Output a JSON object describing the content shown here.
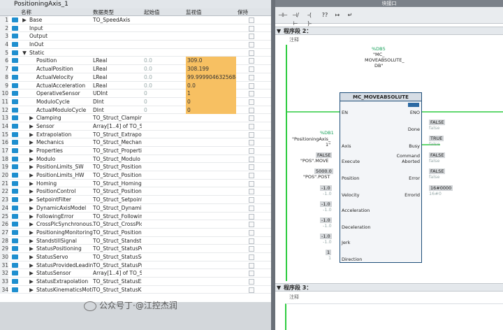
{
  "db_title": "PositioningAxis_1",
  "columns": {
    "name": "名称",
    "type": "数据类型",
    "start": "起始值",
    "monitor": "监视值",
    "retain": "保持"
  },
  "rows": [
    {
      "n": "1",
      "tri": "▶",
      "name": "Base",
      "type": "TO_SpeedAxis",
      "start": "",
      "mon": "",
      "ind": 0
    },
    {
      "n": "2",
      "tri": "",
      "name": "Input",
      "type": "",
      "start": "",
      "mon": "",
      "ind": 0
    },
    {
      "n": "3",
      "tri": "",
      "name": "Output",
      "type": "",
      "start": "",
      "mon": "",
      "ind": 0
    },
    {
      "n": "4",
      "tri": "",
      "name": "InOut",
      "type": "",
      "start": "",
      "mon": "",
      "ind": 0
    },
    {
      "n": "5",
      "tri": "▼",
      "name": "Static",
      "type": "",
      "start": "",
      "mon": "",
      "ind": 0
    },
    {
      "n": "6",
      "tri": "",
      "name": "Position",
      "type": "LReal",
      "start": "0.0",
      "mon": "309.0",
      "ind": 1
    },
    {
      "n": "7",
      "tri": "",
      "name": "ActualPosition",
      "type": "LReal",
      "start": "0.0",
      "mon": "308.199",
      "ind": 1
    },
    {
      "n": "8",
      "tri": "",
      "name": "ActualVelocity",
      "type": "LReal",
      "start": "0.0",
      "mon": "99.9999046325684",
      "ind": 1
    },
    {
      "n": "9",
      "tri": "",
      "name": "ActualAcceleration",
      "type": "LReal",
      "start": "0.0",
      "mon": "0.0",
      "ind": 1
    },
    {
      "n": "10",
      "tri": "",
      "name": "OperativeSensor",
      "type": "UDInt",
      "start": "0",
      "mon": "1",
      "ind": 1
    },
    {
      "n": "11",
      "tri": "",
      "name": "ModuloCycle",
      "type": "DInt",
      "start": "0",
      "mon": "0",
      "ind": 1
    },
    {
      "n": "12",
      "tri": "",
      "name": "ActualModuloCycle",
      "type": "DInt",
      "start": "0",
      "mon": "0",
      "ind": 1
    },
    {
      "n": "13",
      "tri": "▶",
      "name": "Clamping",
      "type": "TO_Struct_Clamping",
      "start": "",
      "mon": "",
      "ind": 1
    },
    {
      "n": "14",
      "tri": "▶",
      "name": "Sensor",
      "type": "Array[1..4] of TO_S...",
      "start": "",
      "mon": "",
      "ind": 1
    },
    {
      "n": "15",
      "tri": "▶",
      "name": "Extrapolation",
      "type": "TO_Struct_Extrapol...",
      "start": "",
      "mon": "",
      "ind": 1
    },
    {
      "n": "16",
      "tri": "▶",
      "name": "Mechanics",
      "type": "TO_Struct_Mechani...",
      "start": "",
      "mon": "",
      "ind": 1
    },
    {
      "n": "17",
      "tri": "▶",
      "name": "Properties",
      "type": "TO_Struct_Properties",
      "start": "",
      "mon": "",
      "ind": 1
    },
    {
      "n": "18",
      "tri": "▶",
      "name": "Modulo",
      "type": "TO_Struct_Modulo",
      "start": "",
      "mon": "",
      "ind": 1
    },
    {
      "n": "19",
      "tri": "▶",
      "name": "PositionLimits_SW",
      "type": "TO_Struct_Position...",
      "start": "",
      "mon": "",
      "ind": 1
    },
    {
      "n": "20",
      "tri": "▶",
      "name": "PositionLimits_HW",
      "type": "TO_Struct_Position...",
      "start": "",
      "mon": "",
      "ind": 1
    },
    {
      "n": "21",
      "tri": "▶",
      "name": "Homing",
      "type": "TO_Struct_Homing",
      "start": "",
      "mon": "",
      "ind": 1
    },
    {
      "n": "22",
      "tri": "▶",
      "name": "PositionControl",
      "type": "TO_Struct_Position...",
      "start": "",
      "mon": "",
      "ind": 1
    },
    {
      "n": "23",
      "tri": "▶",
      "name": "SetpointFilter",
      "type": "TO_Struct_Setpoint...",
      "start": "",
      "mon": "",
      "ind": 1
    },
    {
      "n": "24",
      "tri": "▶",
      "name": "DynamicAxisModel",
      "type": "TO_Struct_Dynami...",
      "start": "",
      "mon": "",
      "ind": 1
    },
    {
      "n": "25",
      "tri": "▶",
      "name": "FollowingError",
      "type": "TO_Struct_Followin...",
      "start": "",
      "mon": "",
      "ind": 1
    },
    {
      "n": "26",
      "tri": "▶",
      "name": "CrossPlcSynchronous...",
      "type": "TO_Struct_CrossPlc...",
      "start": "",
      "mon": "",
      "ind": 1
    },
    {
      "n": "27",
      "tri": "▶",
      "name": "PositioningMonitoring",
      "type": "TO_Struct_Positioni...",
      "start": "",
      "mon": "",
      "ind": 1
    },
    {
      "n": "28",
      "tri": "▶",
      "name": "StandstillSignal",
      "type": "TO_Struct_Standstil...",
      "start": "",
      "mon": "",
      "ind": 1
    },
    {
      "n": "29",
      "tri": "▶",
      "name": "StatusPositioning",
      "type": "TO_Struct_StatusPo...",
      "start": "",
      "mon": "",
      "ind": 1
    },
    {
      "n": "30",
      "tri": "▶",
      "name": "StatusServo",
      "type": "TO_Struct_StatusSe...",
      "start": "",
      "mon": "",
      "ind": 1
    },
    {
      "n": "31",
      "tri": "▶",
      "name": "StatusProvidedLeadin...",
      "type": "TO_Struct_StatusPr...",
      "start": "",
      "mon": "",
      "ind": 1
    },
    {
      "n": "32",
      "tri": "▶",
      "name": "StatusSensor",
      "type": "Array[1..4] of TO_S...",
      "start": "",
      "mon": "",
      "ind": 1
    },
    {
      "n": "33",
      "tri": "▶",
      "name": "StatusExtrapolation",
      "type": "TO_Struct_StatusEx...",
      "start": "",
      "mon": "",
      "ind": 1
    },
    {
      "n": "34",
      "tri": "▶",
      "name": "StatusKinematicsMoti...",
      "type": "TO_Struct_StatusKi...",
      "start": "",
      "mon": "",
      "ind": 1
    }
  ],
  "right_panel": {
    "top_label": "块接口",
    "toolbar": [
      "⊣⊢",
      "⊣/⊢",
      "-( )-",
      "??",
      "↦",
      "↵"
    ],
    "segment2_label": "程序段 2：",
    "segment3_label": "程序段 3：",
    "comment_label": "注释"
  },
  "fb": {
    "instance_db": "%DB5",
    "instance_name_1": "\"MC_",
    "instance_name_2": "MOVEABSOLUTE_",
    "instance_name_3": "DB\"",
    "block_name": "MC_MOVEABSOLUTE",
    "en": "EN",
    "eno": "ENO",
    "axis_db": "%DB1",
    "axis_name_1": "\"PositioningAxis_",
    "axis_name_2": "1\"",
    "inputs": [
      {
        "pin": "Axis",
        "val": "",
        "sym": ""
      },
      {
        "pin": "Execute",
        "val": "FALSE",
        "sym": "\"POS\".MOVE"
      },
      {
        "pin": "Position",
        "val": "5000.0",
        "sym": "\"POS\".POST"
      },
      {
        "pin": "Velocity",
        "val": "-1.0",
        "sym": "-1.0"
      },
      {
        "pin": "Acceleration",
        "val": "-1.0",
        "sym": "-1.0"
      },
      {
        "pin": "Deceleration",
        "val": "-1.0",
        "sym": "-1.0"
      },
      {
        "pin": "Jerk",
        "val": "-1.0",
        "sym": "-1.0"
      },
      {
        "pin": "Direction",
        "val": "1",
        "sym": "1"
      }
    ],
    "outputs": [
      {
        "pin": "Done",
        "val": "FALSE",
        "sym": "false"
      },
      {
        "pin": "Busy",
        "val": "TRUE",
        "sym": "false"
      },
      {
        "pin": "Command Aborted",
        "pin1": "Command",
        "pin2": "Aborted",
        "val": "FALSE",
        "sym": "false"
      },
      {
        "pin": "Error",
        "val": "FALSE",
        "sym": "false"
      },
      {
        "pin": "ErrorId",
        "val": "16#0000",
        "sym": "16#0"
      }
    ]
  },
  "watermark": "公众号丁·@江控杰润",
  "colors": {
    "monitor_bg": "#f7c062",
    "power_rail": "#2ecc40",
    "wire_true": "#2ecc40",
    "block_border": "#1f4e79"
  }
}
